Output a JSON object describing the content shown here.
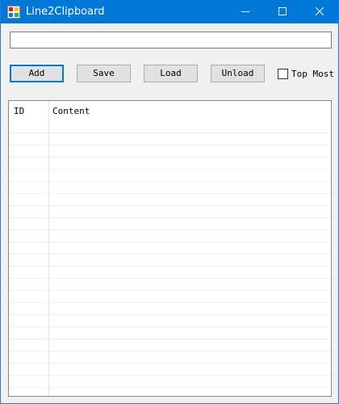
{
  "window": {
    "title": "Line2Clipboard",
    "accent": "#0078d7"
  },
  "icons": {
    "app": "app-icon",
    "minimize": "minimize-icon",
    "maximize": "maximize-icon",
    "close": "close-icon"
  },
  "input": {
    "value": "",
    "placeholder": ""
  },
  "toolbar": {
    "add_label": "Add",
    "save_label": "Save",
    "load_label": "Load",
    "unload_label": "Unload",
    "topmost_label": "Top Most",
    "topmost_checked": false
  },
  "list": {
    "columns": [
      "ID",
      "Content"
    ],
    "rows": []
  }
}
